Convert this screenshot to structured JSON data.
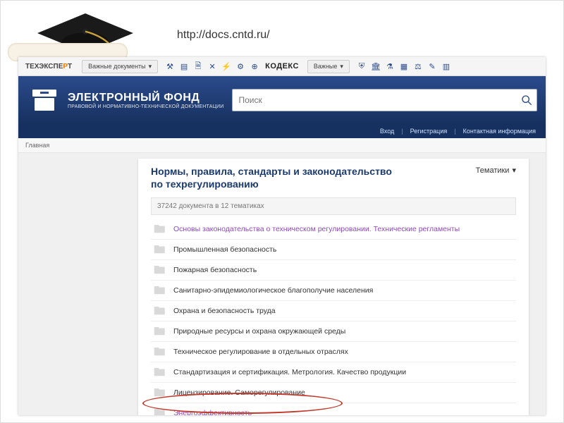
{
  "url_caption": "http://docs.cntd.ru/",
  "toolbar": {
    "brand_prefix": "ТЕХЭКСПЕ",
    "brand_accent": "Р",
    "brand_suffix": "Т",
    "docs_button": "Важные документы",
    "kodeks": "КОДЕКС",
    "important": "Важные"
  },
  "banner": {
    "title": "ЭЛЕКТРОННЫЙ ФОНД",
    "subtitle": "ПРАВОВОЙ И НОРМАТИВНО-ТЕХНИЧЕСКОЙ ДОКУМЕНТАЦИИ",
    "search_placeholder": "Поиск"
  },
  "subbar": {
    "login": "Вход",
    "register": "Регистрация",
    "contact": "Контактная информация"
  },
  "breadcrumb": "Главная",
  "panel": {
    "title": "Нормы, правила, стандарты и законодательство по техрегулированию",
    "dropdown": "Тематики",
    "count": "37242 документа в 12 тематиках",
    "items": [
      {
        "label": "Основы законодательства о техническом регулировании. Технические регламенты",
        "visited": true
      },
      {
        "label": "Промышленная безопасность",
        "visited": false
      },
      {
        "label": "Пожарная безопасность",
        "visited": false
      },
      {
        "label": "Санитарно-эпидемиологическое благополучие населения",
        "visited": false
      },
      {
        "label": "Охрана и безопасность труда",
        "visited": false
      },
      {
        "label": "Природные ресурсы и охрана окружающей среды",
        "visited": false
      },
      {
        "label": "Техническое регулирование в отдельных отраслях",
        "visited": false
      },
      {
        "label": "Стандартизация и сертификация. Метрология. Качество продукции",
        "visited": false
      },
      {
        "label": "Лицензирование. Саморегулирование",
        "visited": false
      },
      {
        "label": "Энергоэффективность",
        "visited": true
      }
    ]
  }
}
